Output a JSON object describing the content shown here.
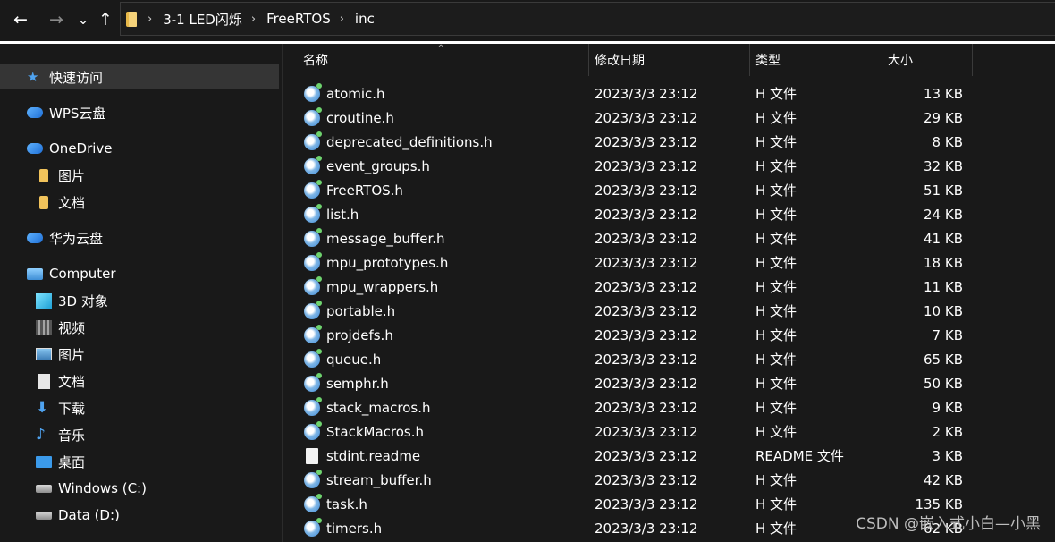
{
  "address": {
    "breadcrumbs": [
      "3-1 LED闪烁",
      "FreeRTOS",
      "inc"
    ],
    "separator": "›"
  },
  "nav_glyphs": {
    "back": "←",
    "forward": "→",
    "recent": "⌄",
    "up": "↑"
  },
  "sidebar": {
    "items": [
      {
        "label": "快速访问",
        "icon": "star-icon"
      },
      {
        "label": "WPS云盘",
        "icon": "cloud-icon"
      },
      {
        "label": "OneDrive",
        "icon": "cloud-icon"
      },
      {
        "label": "图片",
        "icon": "folder-icon"
      },
      {
        "label": "文档",
        "icon": "folder-icon"
      },
      {
        "label": "华为云盘",
        "icon": "cloud-icon"
      },
      {
        "label": "Computer",
        "icon": "computer-icon"
      },
      {
        "label": "3D 对象",
        "icon": "cube-icon"
      },
      {
        "label": "视频",
        "icon": "video-icon"
      },
      {
        "label": "图片",
        "icon": "pictures-icon"
      },
      {
        "label": "文档",
        "icon": "document-icon"
      },
      {
        "label": "下载",
        "icon": "download-icon"
      },
      {
        "label": "音乐",
        "icon": "music-icon"
      },
      {
        "label": "桌面",
        "icon": "desktop-icon"
      },
      {
        "label": "Windows (C:)",
        "icon": "drive-icon"
      },
      {
        "label": "Data (D:)",
        "icon": "drive-icon"
      }
    ]
  },
  "columns": {
    "name": "名称",
    "date": "修改日期",
    "type": "类型",
    "size": "大小",
    "sort_glyph": "^"
  },
  "files": [
    {
      "name": "atomic.h",
      "date": "2023/3/3 23:12",
      "type": "H 文件",
      "size": "13 KB"
    },
    {
      "name": "croutine.h",
      "date": "2023/3/3 23:12",
      "type": "H 文件",
      "size": "29 KB"
    },
    {
      "name": "deprecated_definitions.h",
      "date": "2023/3/3 23:12",
      "type": "H 文件",
      "size": "8 KB"
    },
    {
      "name": "event_groups.h",
      "date": "2023/3/3 23:12",
      "type": "H 文件",
      "size": "32 KB"
    },
    {
      "name": "FreeRTOS.h",
      "date": "2023/3/3 23:12",
      "type": "H 文件",
      "size": "51 KB"
    },
    {
      "name": "list.h",
      "date": "2023/3/3 23:12",
      "type": "H 文件",
      "size": "24 KB"
    },
    {
      "name": "message_buffer.h",
      "date": "2023/3/3 23:12",
      "type": "H 文件",
      "size": "41 KB"
    },
    {
      "name": "mpu_prototypes.h",
      "date": "2023/3/3 23:12",
      "type": "H 文件",
      "size": "18 KB"
    },
    {
      "name": "mpu_wrappers.h",
      "date": "2023/3/3 23:12",
      "type": "H 文件",
      "size": "11 KB"
    },
    {
      "name": "portable.h",
      "date": "2023/3/3 23:12",
      "type": "H 文件",
      "size": "10 KB"
    },
    {
      "name": "projdefs.h",
      "date": "2023/3/3 23:12",
      "type": "H 文件",
      "size": "7 KB"
    },
    {
      "name": "queue.h",
      "date": "2023/3/3 23:12",
      "type": "H 文件",
      "size": "65 KB"
    },
    {
      "name": "semphr.h",
      "date": "2023/3/3 23:12",
      "type": "H 文件",
      "size": "50 KB"
    },
    {
      "name": "stack_macros.h",
      "date": "2023/3/3 23:12",
      "type": "H 文件",
      "size": "9 KB"
    },
    {
      "name": "StackMacros.h",
      "date": "2023/3/3 23:12",
      "type": "H 文件",
      "size": "2 KB"
    },
    {
      "name": "stdint.readme",
      "date": "2023/3/3 23:12",
      "type": "README 文件",
      "size": "3 KB",
      "plain": true
    },
    {
      "name": "stream_buffer.h",
      "date": "2023/3/3 23:12",
      "type": "H 文件",
      "size": "42 KB"
    },
    {
      "name": "task.h",
      "date": "2023/3/3 23:12",
      "type": "H 文件",
      "size": "135 KB"
    },
    {
      "name": "timers.h",
      "date": "2023/3/3 23:12",
      "type": "H 文件",
      "size": "62 KB"
    }
  ],
  "watermark": "CSDN @嵌入式小白—小黑",
  "colors": {
    "background": "#191919",
    "selected": "#353535",
    "accent": "#3a86d4"
  }
}
